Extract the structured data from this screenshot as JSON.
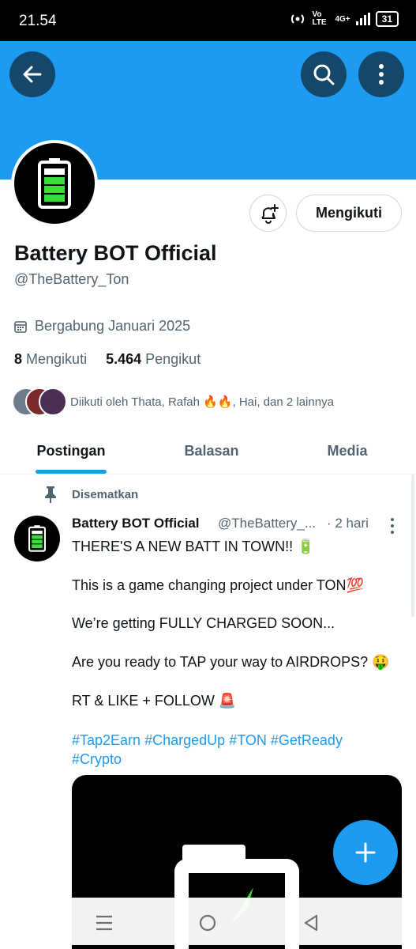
{
  "status_bar": {
    "time": "21.54",
    "network_label": "Vo LTE",
    "signal_label": "4G+",
    "battery_level": "31"
  },
  "colors": {
    "accent": "#1d9bf0",
    "text_primary": "#0f1419",
    "text_secondary": "#536471",
    "battery_green": "#3ddc3d"
  },
  "header": {
    "back_icon": "arrow-left-icon",
    "search_icon": "search-icon",
    "more_icon": "more-vertical-icon"
  },
  "profile": {
    "name": "Battery BOT Official",
    "handle": "@TheBattery_Ton",
    "joined": "Bergabung Januari 2025",
    "following_count": "8",
    "following_label": "Mengikuti",
    "followers_count": "5.464",
    "followers_label": "Pengikut",
    "followed_by": "Diikuti oleh Thata, Rafah 🔥🔥, Hai, dan 2 lainnya",
    "follow_button": "Mengikuti",
    "notify_icon": "bell-plus-icon"
  },
  "tabs": [
    {
      "label": "Postingan",
      "active": true
    },
    {
      "label": "Balasan",
      "active": false
    },
    {
      "label": "Media",
      "active": false
    }
  ],
  "pinned_tweet": {
    "pinned_label": "Disematkan",
    "author_name": "Battery BOT Official",
    "author_handle": "@TheBattery_...",
    "time": "· 2 hari",
    "lines": [
      "THERE'S A NEW BATT IN TOWN!! 🔋",
      "This is a game changing project under TON💯",
      "We’re getting FULLY CHARGED SOON...",
      "Are you ready to TAP your way to AIRDROPS? 🤑",
      "RT & LIKE + FOLLOW 🚨"
    ],
    "hashtags": [
      "#Tap2Earn",
      "#ChargedUp",
      "#TON",
      "#GetReady",
      "#Crypto"
    ]
  },
  "fab_icon": "plus-icon",
  "nav": {
    "menu_icon": "menu-icon",
    "home_icon": "home-circle-icon",
    "back_icon": "back-triangle-icon"
  }
}
